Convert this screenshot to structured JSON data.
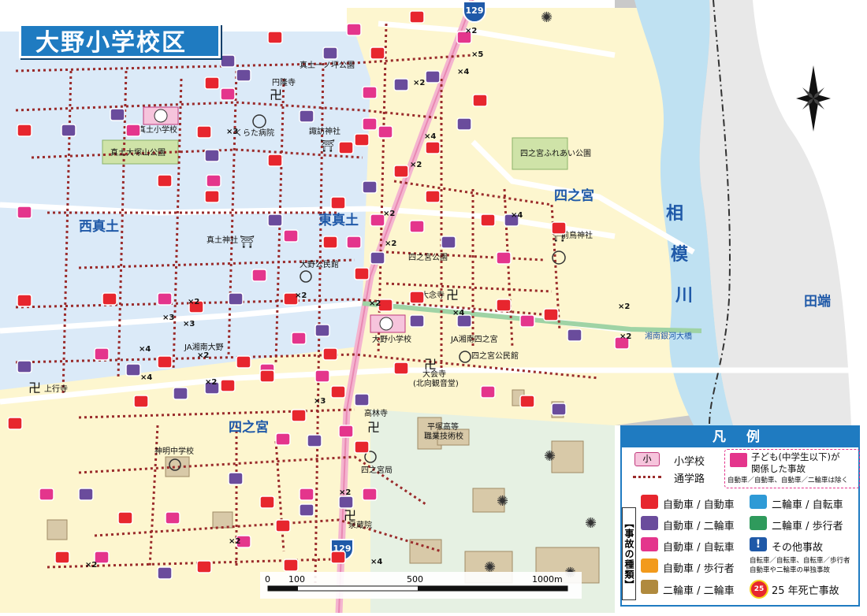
{
  "title": "大野小学校区",
  "route_number": "129",
  "districts": {
    "nishi_mado": "西真土",
    "higashi_mado": "東真土",
    "shinomiya_ne": "四之宮",
    "shinomiya_sw": "四之宮",
    "taba": "田端"
  },
  "river": {
    "name_1": "相",
    "name_2": "模",
    "name_3": "川"
  },
  "bridge": "湘南銀河大橋",
  "places": {
    "mado_school": "真土小学校",
    "mado_otsukayama_park": "真土大塚山公園",
    "kurata_hospital": "くらた病院",
    "enryuji": "円隆寺",
    "suwa_shrine": "諏訪神社",
    "mado_ichinotsubo_park": "真土一ノ坪公園",
    "mado_shrine": "真土神社",
    "ono_kominkan": "大野公民館",
    "shinomiya_park": "四之宮公園",
    "shinomiya_fureai_park": "四之宮ふれあい公園",
    "maetori_shrine": "前鳥神社",
    "dainenji": "大念寺",
    "ono_school": "大野小学校",
    "ja_shinomiya": "JA湘南四之宮",
    "ja_ono": "JA湘南大野",
    "shinomiya_kominkan": "四之宮公民館",
    "daikaiji": "大会寺",
    "daikaiji_sub": "(北向観音堂)",
    "jogyoji": "上行寺",
    "kotakuji": "高林寺",
    "hiratsuka_tech": "平塚高等",
    "hiratsuka_tech_2": "職業技術校",
    "shinmei_jhs": "神明中学校",
    "shinomiya_post": "四之宮局",
    "senzoin": "泉蔵院"
  },
  "accident_counts": [
    "×2",
    "×4",
    "×5",
    "×2",
    "×4",
    "×2",
    "×3",
    "×2",
    "×4",
    "×2",
    "×2",
    "×2",
    "×4",
    "×2",
    "×3",
    "×3",
    "×4",
    "×2",
    "×4",
    "×2",
    "×3",
    "×2",
    "×4",
    "×2",
    "×2",
    "×2",
    "×2"
  ],
  "scale": {
    "t0": "0",
    "t100": "100",
    "t500": "500",
    "t1000": "1000m"
  },
  "legend": {
    "title": "凡 例",
    "school": "小学校",
    "school_icon": "小",
    "route": "通学路",
    "child_accident_1": "子ども(中学生以下)が",
    "child_accident_2": "関係した事故",
    "child_accident_note": "自動車／自動車、自動車／二輪車は除く",
    "types_label": "【事故の種類】",
    "car_car": "自動車 / 自動車",
    "car_moto": "自動車 / 二輪車",
    "car_bike": "自動車 / 自転車",
    "car_ped": "自動車 / 歩行者",
    "moto_moto": "二輪車 / 二輪車",
    "moto_bike": "二輪車 / 自転車",
    "moto_ped": "二輪車 / 歩行者",
    "other": "その他事故",
    "other_note_1": "自転車／自転車、自転車／歩行者",
    "other_note_2": "自動車や二輪車の単独事故",
    "fatal": "25 年死亡事故",
    "fatal_icon": "25"
  },
  "colors": {
    "district_blue": "#dbeaf8",
    "district_yellow": "#fdf6cf",
    "district_green": "#e6f1e3",
    "river": "#bfe1f2",
    "floodplain": "#c9c9c9",
    "route": "#9a2b2b",
    "accent": "#1f7bc1",
    "car_car": "#e7262e",
    "car_moto": "#6a4c9c",
    "car_bike": "#e4358c",
    "car_ped": "#f29a1c",
    "moto_moto": "#b08a3e",
    "moto_bike": "#2e9ad6",
    "moto_ped": "#2f9a5c",
    "other": "#1f59a8"
  }
}
